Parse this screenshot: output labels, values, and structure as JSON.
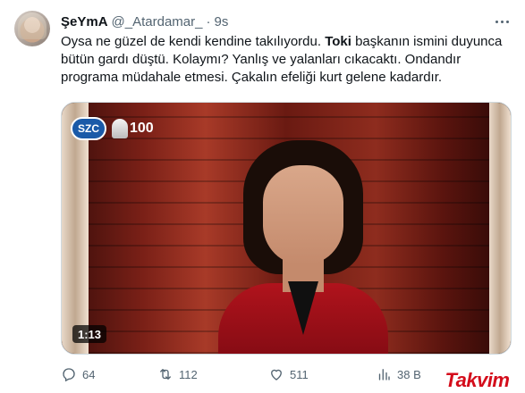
{
  "tweet": {
    "author_name": "ŞeYmA",
    "handle": "@_Atardamar_",
    "separator": "·",
    "time": "9s",
    "text_before": "Oysa ne güzel de kendi kendine takılıyordu. ",
    "text_bold": "Toki",
    "text_after": " başkanın ismini duyunca bütün gardı düştü. Kolaymı? Yanlış ve yalanları cıkacaktı. Ondandır programa müdahale etmesi. Çakalın efeliği kurt gelene kadardır."
  },
  "media": {
    "channel_logo": "SZC",
    "anniversary_logo": "100",
    "duration": "1:13"
  },
  "actions": {
    "reply_count": "64",
    "retweet_count": "112",
    "like_count": "511",
    "views_count": "38 B"
  },
  "watermark": {
    "text": "Takvim"
  },
  "icons": {
    "more": "more-horizontal-icon",
    "reply": "reply-icon",
    "retweet": "retweet-icon",
    "like": "heart-icon",
    "views": "views-chart-icon",
    "bookmark": "bookmark-icon"
  },
  "colors": {
    "text": "#0f1419",
    "secondary": "#536471",
    "border": "#cfd9de",
    "watermark": "#d40d1b",
    "channel_logo_bg": "#1a5aa8"
  }
}
